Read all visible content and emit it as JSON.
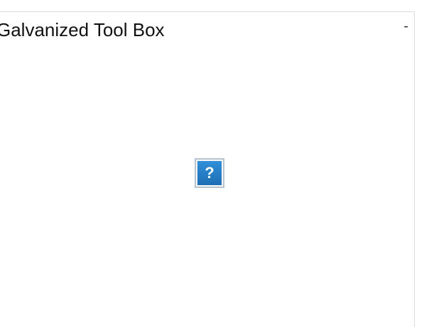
{
  "panel": {
    "title": "Galvanized Tool Box",
    "collapse_label": "-",
    "image_placeholder_label": "?"
  }
}
